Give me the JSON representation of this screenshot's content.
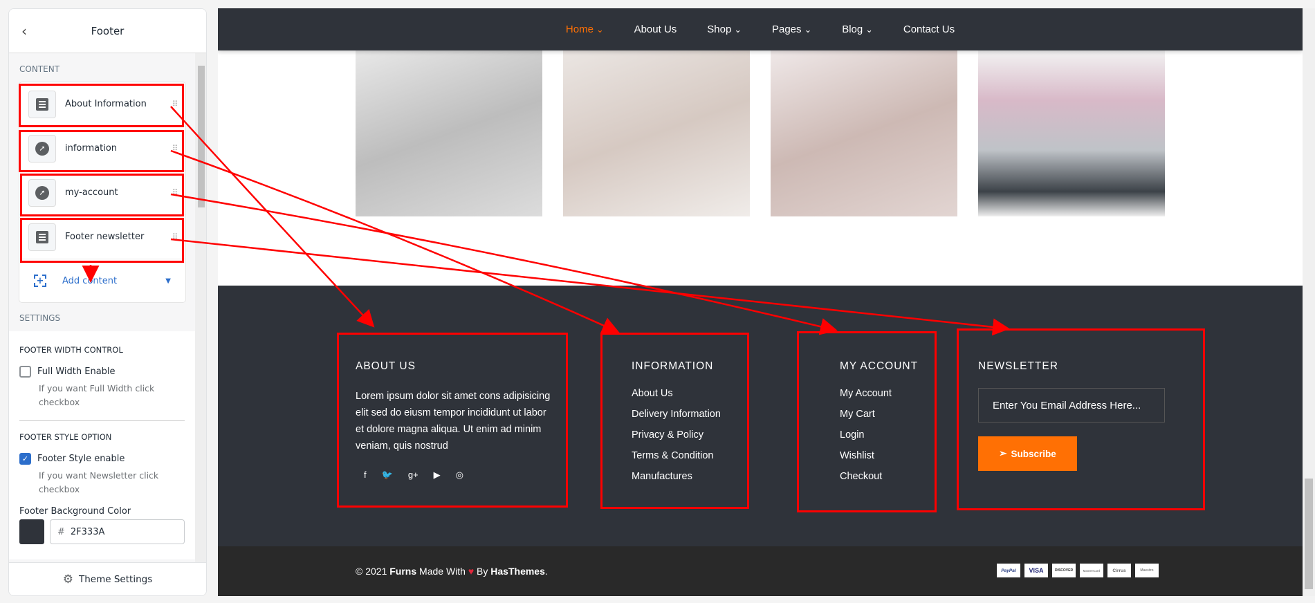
{
  "panel": {
    "title": "Footer",
    "content_heading": "CONTENT",
    "blocks": [
      {
        "label": "About Information",
        "icon": "text-block-icon"
      },
      {
        "label": "information",
        "icon": "compass-icon"
      },
      {
        "label": "my-account",
        "icon": "compass-icon"
      },
      {
        "label": "Footer newsletter",
        "icon": "text-block-icon"
      }
    ],
    "add_content": "Add content",
    "settings_heading": "SETTINGS",
    "width_heading": "FOOTER WIDTH CONTROL",
    "full_width_label": "Full Width Enable",
    "full_width_checked": false,
    "full_width_help": "If you want Full Width click checkbox",
    "style_heading": "FOOTER STYLE OPTION",
    "style_label": "Footer Style enable",
    "style_checked": true,
    "style_help": "If you want Newsletter click checkbox",
    "bg_label": "Footer Background Color",
    "bg_hash": "#",
    "bg_value": "2F333A",
    "bg_color": "#2F333A",
    "theme_settings": "Theme Settings"
  },
  "nav": [
    "Home",
    "About Us",
    "Shop",
    "Pages",
    "Blog",
    "Contact Us"
  ],
  "footer": {
    "about": {
      "title": "ABOUT US",
      "text": "Lorem ipsum dolor sit amet cons adipisicing elit sed do eiusm tempor incididunt ut labor et dolore magna aliqua. Ut enim ad minim veniam, quis nostrud",
      "social": [
        "f",
        "🐦",
        "g+",
        "▶",
        "◎"
      ]
    },
    "information": {
      "title": "INFORMATION",
      "links": [
        "About Us",
        "Delivery Information",
        "Privacy & Policy",
        "Terms & Condition",
        "Manufactures"
      ]
    },
    "account": {
      "title": "MY ACCOUNT",
      "links": [
        "My Account",
        "My Cart",
        "Login",
        "Wishlist",
        "Checkout"
      ]
    },
    "newsletter": {
      "title": "NEWSLETTER",
      "placeholder": "Enter You Email Address Here...",
      "button": "Subscribe"
    }
  },
  "copyright": {
    "prefix": "© 2021",
    "brand": "Furns",
    "made": "Made With",
    "by": "By",
    "company": "HasThemes",
    "suffix": "."
  },
  "payments": [
    "PayPal",
    "VISA",
    "DISCOVER",
    "MasterCard",
    "Cirrus",
    "Maestro"
  ],
  "colors": {
    "accent": "#FF7004",
    "footer_bg": "#2F333A",
    "annotation": "#FF0000"
  }
}
